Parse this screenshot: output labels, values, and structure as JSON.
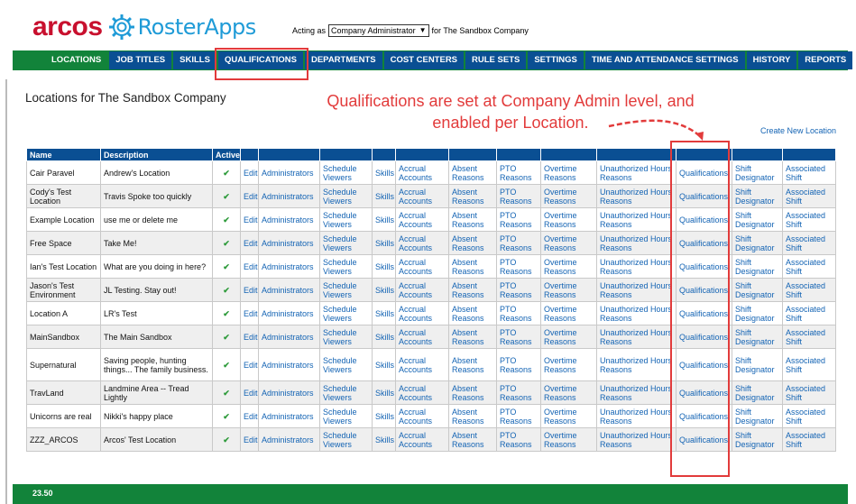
{
  "brand": {
    "arcos": "arcos",
    "roster": "RosterApps",
    "red": "#c8102e",
    "blue": "#1f9bd7"
  },
  "acting": {
    "prefix": "Acting as",
    "role": "Company Administrator",
    "suffix": "for The Sandbox Company"
  },
  "nav": {
    "tabs": [
      {
        "label": "LOCATIONS",
        "active": true
      },
      {
        "label": "JOB TITLES"
      },
      {
        "label": "SKILLS"
      },
      {
        "label": "QUALIFICATIONS"
      },
      {
        "label": "DEPARTMENTS"
      },
      {
        "label": "COST CENTERS"
      },
      {
        "label": "RULE SETS"
      },
      {
        "label": "SETTINGS"
      },
      {
        "label": "TIME AND ATTENDANCE SETTINGS"
      },
      {
        "label": "HISTORY"
      },
      {
        "label": "REPORTS"
      }
    ]
  },
  "page": {
    "title": "Locations for The Sandbox Company",
    "create_link": "Create New Location"
  },
  "annotation": {
    "line1": "Qualifications are set at Company Admin level, and",
    "line2": "enabled per Location.",
    "color": "#e23b3b"
  },
  "table": {
    "headers": [
      "Name",
      "Description",
      "Active",
      "",
      "",
      "",
      "",
      "",
      "",
      "",
      "",
      "",
      "",
      "",
      ""
    ],
    "link_labels": {
      "edit": "Edit",
      "administrators": "Administrators",
      "schedule_viewers": "Schedule Viewers",
      "skills": "Skills",
      "accrual_accounts": "Accrual Accounts",
      "absent_reasons": "Absent Reasons",
      "pto_reasons": "PTO Reasons",
      "overtime_reasons": "Overtime Reasons",
      "unauthorized_hours_reasons": "Unauthorized Hours Reasons",
      "qualifications": "Qualifications",
      "shift_designator": "Shift Designator",
      "associated_shift": "Associated Shift"
    },
    "check": "✔",
    "rows": [
      {
        "name": "Cair Paravel",
        "description": "Andrew's Location"
      },
      {
        "name": "Cody's Test Location",
        "description": "Travis Spoke too quickly"
      },
      {
        "name": "Example Location",
        "description": "use me or delete me"
      },
      {
        "name": "Free Space",
        "description": "Take Me!"
      },
      {
        "name": "Ian's Test Location",
        "description": "What are you doing in here?"
      },
      {
        "name": "Jason's Test Environment",
        "description": "JL Testing. Stay out!"
      },
      {
        "name": "Location A",
        "description": "LR's Test"
      },
      {
        "name": "MainSandbox",
        "description": "The Main Sandbox"
      },
      {
        "name": "Supernatural",
        "description": "Saving people, hunting things... The family business."
      },
      {
        "name": "TravLand",
        "description": "Landmine Area -- Tread Lightly"
      },
      {
        "name": "Unicorns are real",
        "description": "Nikki's happy place"
      },
      {
        "name": "ZZZ_ARCOS",
        "description": "Arcos' Test Location"
      }
    ]
  },
  "footer": {
    "version": "23.50"
  },
  "colors": {
    "nav_blue": "#0a4f93",
    "green": "#12833a",
    "link": "#1464b4",
    "check": "#2e9b3b"
  }
}
